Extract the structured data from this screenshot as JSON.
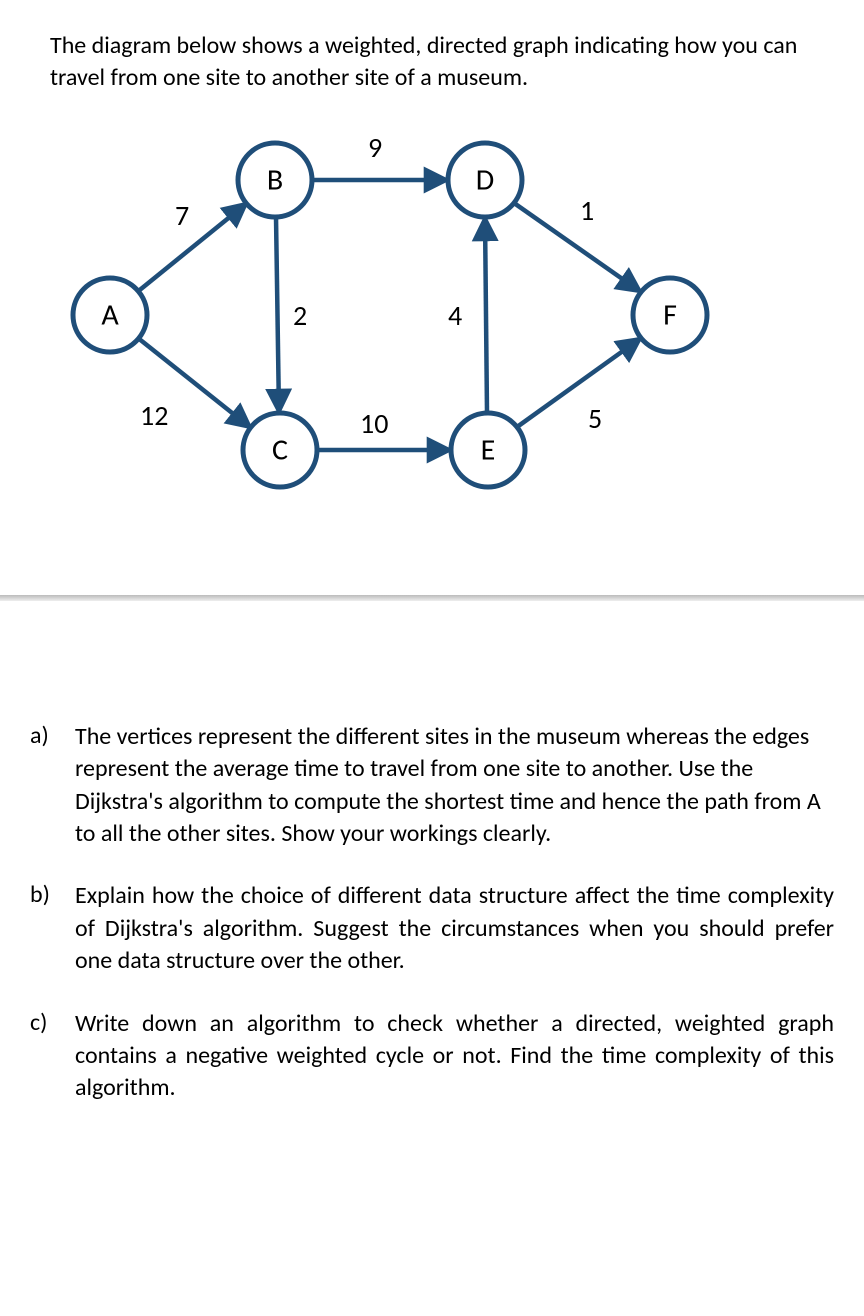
{
  "intro": "The diagram below shows a weighted, directed graph indicating how you can travel from one site to another site of a museum.",
  "chart_data": {
    "type": "graph",
    "directed": true,
    "weighted": true,
    "nodes": [
      "A",
      "B",
      "C",
      "D",
      "E",
      "F"
    ],
    "edges": [
      {
        "from": "A",
        "to": "B",
        "weight": 7
      },
      {
        "from": "A",
        "to": "C",
        "weight": 12
      },
      {
        "from": "B",
        "to": "C",
        "weight": 2
      },
      {
        "from": "B",
        "to": "D",
        "weight": 9
      },
      {
        "from": "C",
        "to": "E",
        "weight": 10
      },
      {
        "from": "E",
        "to": "D",
        "weight": 4
      },
      {
        "from": "D",
        "to": "F",
        "weight": 1
      },
      {
        "from": "E",
        "to": "F",
        "weight": 5
      }
    ]
  },
  "questions": {
    "a": {
      "label": "a)",
      "text": "The vertices represent the different sites in the museum whereas the edges represent the average time to travel from one site to another. Use the Dijkstra's algorithm to compute the shortest time and hence the path from A to all the other sites. Show your workings clearly."
    },
    "b": {
      "label": "b)",
      "text": "Explain how the choice of different data structure affect the time complexity of Dijkstra's algorithm. Suggest the circumstances when you should prefer one data structure over the other."
    },
    "c": {
      "label": "c)",
      "text": "Write down an algorithm to check whether a directed, weighted graph contains a negative weighted cycle or not. Find the time complexity of this algorithm."
    }
  }
}
